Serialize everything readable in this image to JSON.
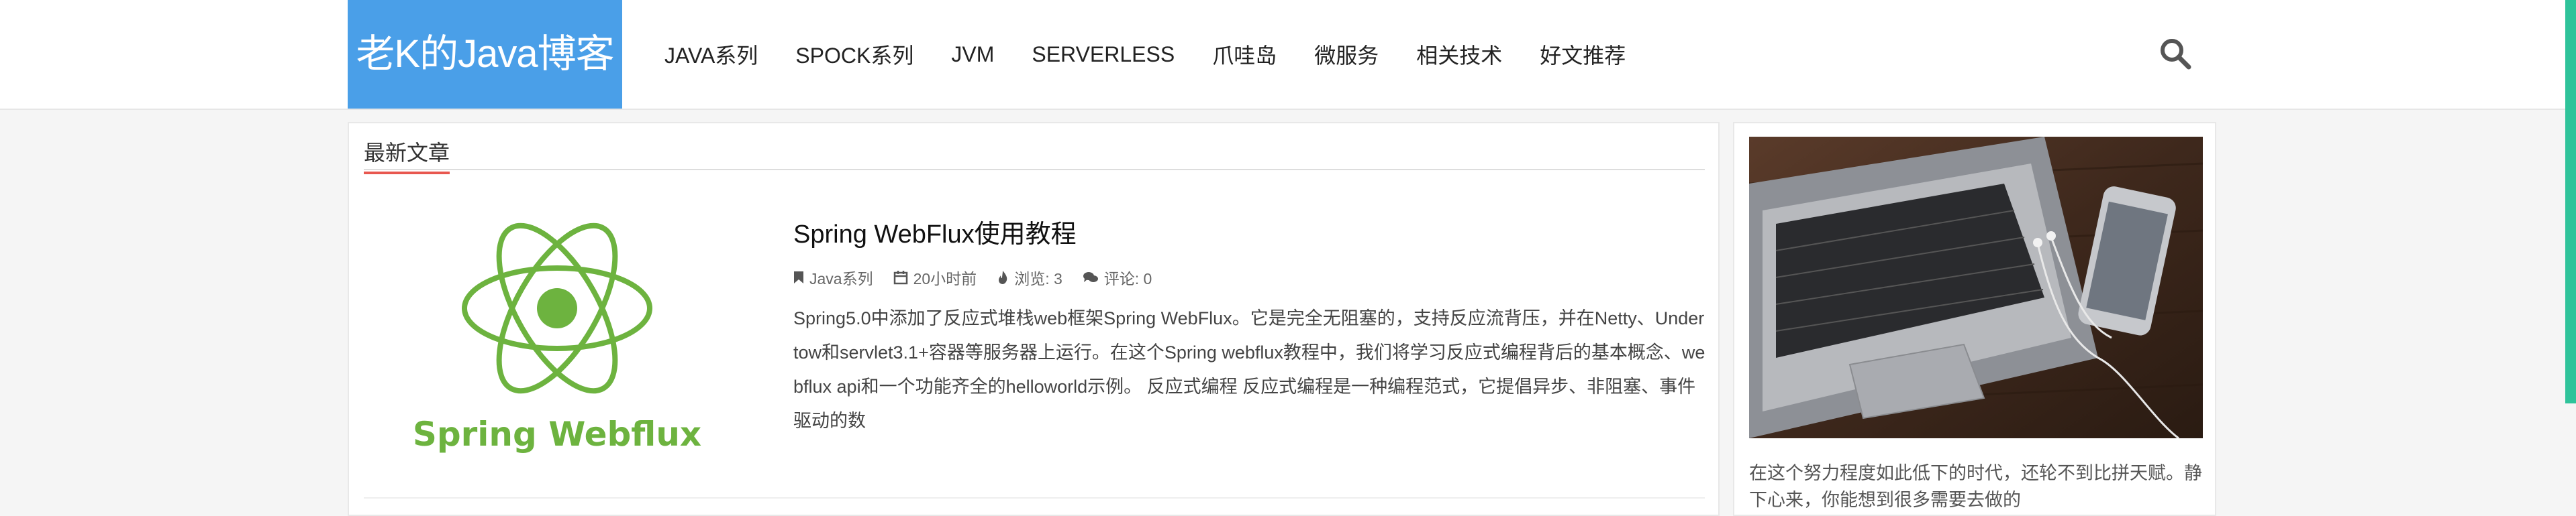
{
  "header": {
    "logo": "老K的Java博客",
    "nav": [
      "JAVA系列",
      "SPOCK系列",
      "JVM",
      "SERVERLESS",
      "爪哇岛",
      "微服务",
      "相关技术",
      "好文推荐"
    ],
    "search_icon": "search-icon"
  },
  "main": {
    "section_title": "最新文章",
    "articles": [
      {
        "thumb_text": "Spring Webflux",
        "title": "Spring WebFlux使用教程",
        "category": "Java系列",
        "time": "20小时前",
        "views": "浏览: 3",
        "comments": "评论: 0",
        "excerpt": "Spring5.0中添加了反应式堆栈web框架Spring WebFlux。它是完全无阻塞的，支持反应流背压，并在Netty、Undertow和servlet3.1+容器等服务器上运行。在这个Spring webflux教程中，我们将学习反应式编程背后的基本概念、webflux api和一个功能齐全的helloworld示例。 反应式编程 反应式编程是一种编程范式，它提倡异步、非阻塞、事件驱动的数"
      }
    ]
  },
  "sidebar": {
    "text": "在这个努力程度如此低下的时代，还轮不到比拼天赋。静下心来，你能想到很多需要去做的"
  },
  "colors": {
    "logo_bg": "#4a9fe8",
    "tab_underline": "#e8574f",
    "spring_green": "#6db33f",
    "scroll_accent": "#2fc39a"
  }
}
